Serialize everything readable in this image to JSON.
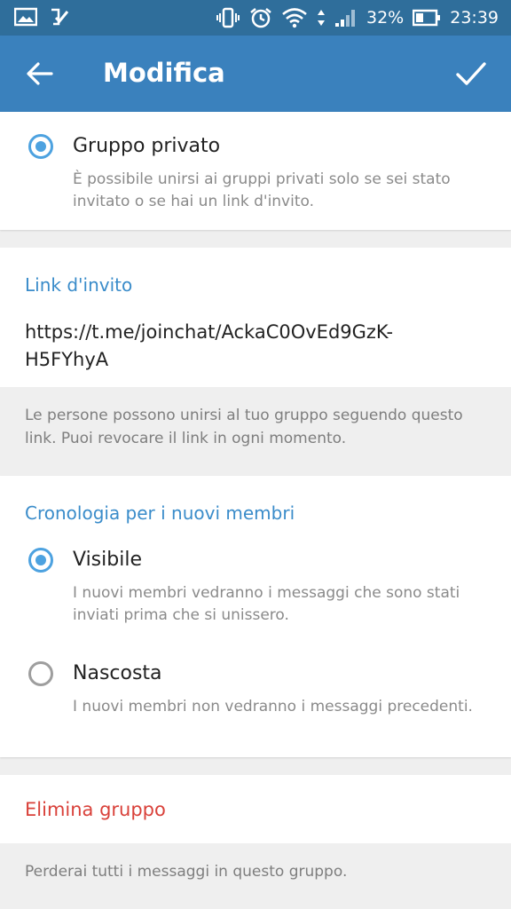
{
  "status_bar": {
    "battery_percent": "32%",
    "time": "23:39"
  },
  "toolbar": {
    "title": "Modifica"
  },
  "group_type": {
    "option_label": "Gruppo privato",
    "option_desc": "È possibile unirsi ai gruppi privati solo se sei stato invitato o se hai un link d'invito.",
    "selected": true
  },
  "invite": {
    "header": "Link d'invito",
    "link_line1": "https://t.me/joinchat/AckaC0OvEd9GzK-",
    "link_line2": "H5FYhyA",
    "note": "Le persone possono unirsi al tuo gruppo seguendo questo link. Puoi revocare il link in ogni momento."
  },
  "history": {
    "header": "Cronologia per i nuovi membri",
    "options": [
      {
        "label": "Visibile",
        "desc": "I nuovi membri vedranno i messaggi che sono stati inviati prima che si unissero.",
        "selected": true
      },
      {
        "label": "Nascosta",
        "desc": "I nuovi membri non vedranno i messaggi precedenti.",
        "selected": false
      }
    ]
  },
  "delete": {
    "label": "Elimina gruppo",
    "note": "Perderai tutti i messaggi in questo gruppo."
  },
  "colors": {
    "toolbar": "#3a81bd",
    "statusbar": "#2f6e9b",
    "accent": "#4da2e0",
    "danger": "#d9413a"
  }
}
